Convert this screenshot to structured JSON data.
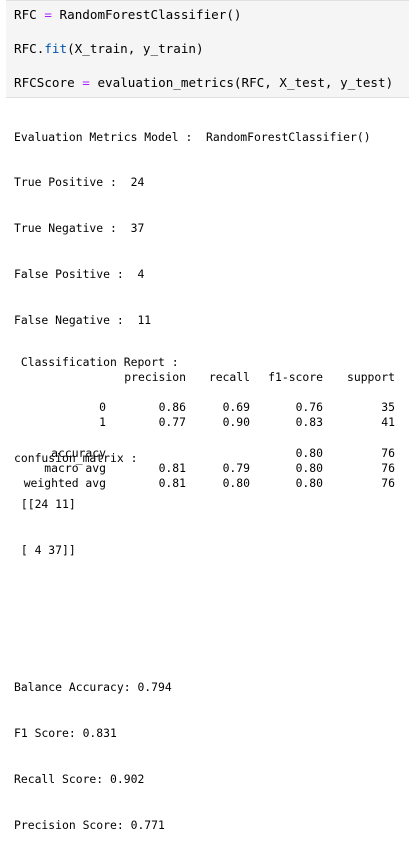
{
  "code_cell": {
    "line1": {
      "lhs": "RFC",
      "op": "=",
      "call": "RandomForestClassifier()"
    },
    "line2": {
      "obj": "RFC",
      "dot": ".",
      "fn": "fit",
      "args": "(X_train, y_train)"
    },
    "line3": {
      "lhs": "RFCScore",
      "op": "=",
      "call": "evaluation_metrics(RFC, X_test, y_test)"
    }
  },
  "output": {
    "lines": [
      "Evaluation Metrics Model :  RandomForestClassifier()",
      "True Positive :  24",
      "True Negative :  37",
      "False Positive :  4",
      "False Negative :  11",
      "",
      "",
      "confusion_matrix :",
      " [[24 11]",
      " [ 4 37]]",
      "",
      "",
      "Balance Accuracy: 0.794",
      "F1 Score: 0.831",
      "Recall Score: 0.902",
      "Precision Score: 0.771"
    ],
    "report_title": " Classification Report :",
    "report_header": [
      "",
      "precision",
      "recall",
      "f1-score",
      "support"
    ],
    "report_rows": [
      [
        "",
        "",
        "",
        "",
        ""
      ],
      [
        "0",
        "0.86",
        "0.69",
        "0.76",
        "35"
      ],
      [
        "1",
        "0.77",
        "0.90",
        "0.83",
        "41"
      ],
      [
        "",
        "",
        "",
        "",
        ""
      ],
      [
        "accuracy",
        "",
        "",
        "0.80",
        "76"
      ],
      [
        "macro avg",
        "0.81",
        "0.79",
        "0.80",
        "76"
      ],
      [
        "weighted avg",
        "0.81",
        "0.80",
        "0.80",
        "76"
      ]
    ]
  },
  "colors": {
    "cell_background": "#f5f5f5",
    "operator": "#aa22ff",
    "function": "#0055aa"
  }
}
